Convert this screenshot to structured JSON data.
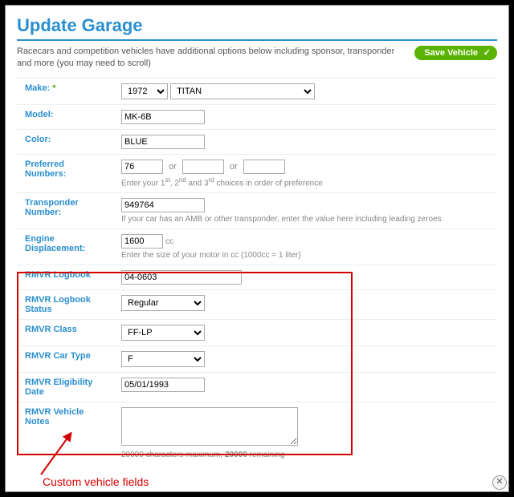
{
  "title": "Update Garage",
  "intro": "Racecars and competition vehicles have additional options below including sponsor, transponder and more (you may need to scroll)",
  "save_label": "Save Vehicle",
  "labels": {
    "make": "Make:",
    "model": "Model:",
    "color": "Color:",
    "pref_numbers": "Preferred Numbers:",
    "transponder": "Transponder Number:",
    "engine": "Engine Displacement:",
    "rmvr_logbook": "RMVR Logbook",
    "rmvr_logbook_status": "RMVR Logbook Status",
    "rmvr_class": "RMVR Class",
    "rmvr_car_type": "RMVR Car Type",
    "rmvr_elig_date": "RMVR Eligibility Date",
    "rmvr_notes": "RMVR Vehicle Notes"
  },
  "values": {
    "make_year": "1972",
    "make_name": "TITAN",
    "model": "MK-6B",
    "color": "BLUE",
    "pref1": "76",
    "pref2": "",
    "pref3": "",
    "transponder": "949764",
    "engine_cc": "1600",
    "rmvr_logbook": "04-0603",
    "rmvr_logbook_status": "Regular",
    "rmvr_class": "FF-LP",
    "rmvr_car_type": "F",
    "rmvr_elig_date": "05/01/1993",
    "rmvr_notes": ""
  },
  "hints": {
    "pref_pre": "Enter your 1",
    "pref_mid1": ", 2",
    "pref_mid2": " and 3",
    "pref_post": " choices in order of preference",
    "transponder": "If your car has an AMB or other transponder, enter the value here including leading zeroes",
    "engine": "Enter the size of your motor in cc (1000cc = 1 liter)",
    "notes_pre": "20000 characters maximum, ",
    "notes_remaining": "20000",
    "notes_post": " remaining",
    "or": "or",
    "cc": "cc"
  },
  "annotation": "Custom vehicle fields"
}
